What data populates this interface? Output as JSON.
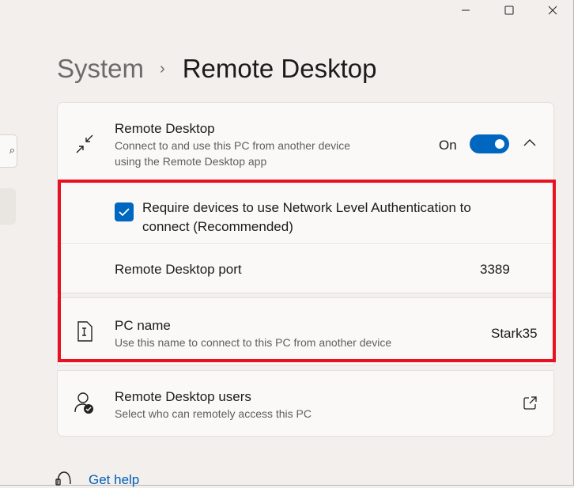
{
  "breadcrumb": {
    "parent": "System",
    "separator": "›",
    "current": "Remote Desktop"
  },
  "remote_desktop": {
    "title": "Remote Desktop",
    "description": "Connect to and use this PC from another device using the Remote Desktop app",
    "state_label": "On",
    "enabled": true
  },
  "nla": {
    "label": "Require devices to use Network Level Authentication to connect (Recommended)",
    "checked": true
  },
  "port": {
    "label": "Remote Desktop port",
    "value": "3389"
  },
  "pc_name": {
    "title": "PC name",
    "description": "Use this name to connect to this PC from another device",
    "value": "Stark35"
  },
  "users": {
    "title": "Remote Desktop users",
    "description": "Select who can remotely access this PC"
  },
  "help": {
    "label": "Get help"
  },
  "colors": {
    "accent": "#0067c0",
    "highlight": "#e81123",
    "link": "#0060b8"
  },
  "icons": [
    "minimize-icon",
    "maximize-icon",
    "close-icon",
    "remote-desktop-icon",
    "chevron-up-icon",
    "checkmark-icon",
    "pc-name-icon",
    "users-icon",
    "open-external-icon",
    "help-icon"
  ]
}
